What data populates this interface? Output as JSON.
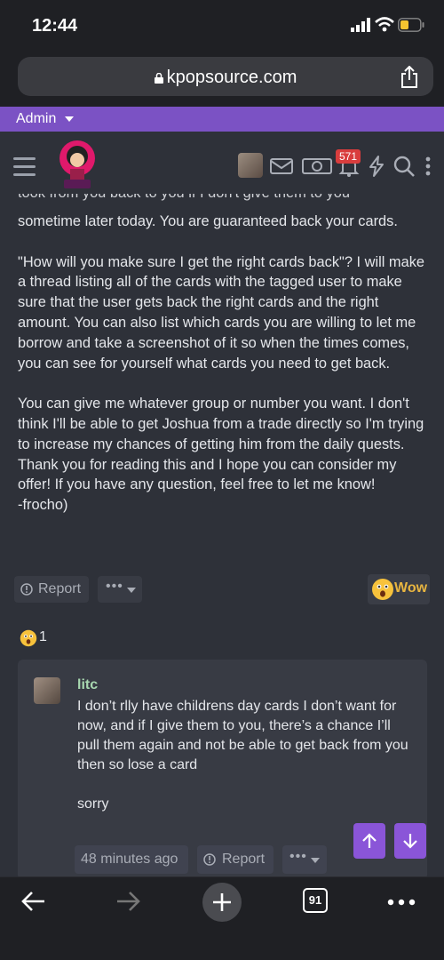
{
  "status_bar": {
    "time": "12:44"
  },
  "browser": {
    "url": "kpopsource.com"
  },
  "admin_bar": {
    "label": "Admin"
  },
  "header": {
    "notification_count": "571"
  },
  "post": {
    "cut_line": "took from you back to you if I don't give them to you",
    "paragraphs": [
      "sometime later today. You are guaranteed back your cards.",
      "\"How will you make sure I get the right cards back\"? I will make a thread listing all of the cards with the tagged user to make sure that the user gets back the right cards and the right amount. You can also list which cards you are willing to let me borrow and take a screenshot of it so when the times comes, you can see for yourself what cards you need to get back.",
      "You can give me whatever group or number you want. I don't think I'll be able to get Joshua from a trade directly so I'm trying to increase my chances of getting him from the daily quests. Thank you for reading this and I hope you can consider my offer! If you have any question, feel free to let me know!\n-frocho)"
    ],
    "report_label": "Report",
    "more_label": "•••",
    "reaction_label": "Wow",
    "reaction_count": "1"
  },
  "reply": {
    "author": "litc",
    "paragraphs": [
      "I don’t rlly have childrens day cards I don’t want for now, and if I give them to you, there’s a chance I’ll pull them again and not be able to get back from you then so lose a card",
      "sorry"
    ],
    "time": "48 minutes ago",
    "report_label": "Report",
    "more_label": "•••"
  },
  "bottom_bar": {
    "tab_count": "91"
  },
  "icons": {
    "share": "share-icon",
    "lock": "lock-icon",
    "menu": "hamburger-icon",
    "mail": "envelope-icon",
    "money": "money-icon",
    "bell": "bell-icon",
    "bolt": "lightning-icon",
    "search": "search-icon",
    "more": "vertical-dots-icon",
    "report": "flag-icon",
    "wow": "wow-emoji-icon",
    "back": "back-arrow-icon",
    "forward": "forward-arrow-icon",
    "add": "plus-icon",
    "tabs": "tabs-icon",
    "browser_menu": "horizontal-dots-icon",
    "scroll_up": "arrow-up-icon",
    "scroll_down": "arrow-down-icon"
  },
  "colors": {
    "accent": "#7b52c4",
    "scroll_button": "#8a55d8",
    "background": "#2e3139",
    "reaction": "#e8b540",
    "author": "#a8d8b0",
    "badge": "#d93d3d"
  }
}
